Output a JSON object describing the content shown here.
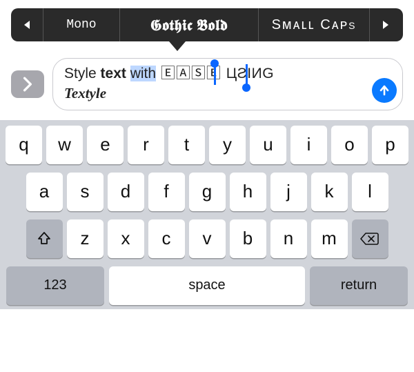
{
  "picker": {
    "prev_icon": "◀",
    "next_icon": "▶",
    "items": [
      "Mono",
      "𝕲𝖔𝖙𝖍𝖎𝖈 𝕭𝖔𝖑𝖉",
      "Sᴍᴀʟʟ Cᴀᴘs"
    ],
    "active_index": 1
  },
  "compose": {
    "segments": {
      "a": "Style ",
      "b": "text ",
      "c": "with",
      "d": " 🄴🄰🅂🄴 ",
      "e": "ЦƧIИG",
      "f": "Textyle"
    }
  },
  "keyboard": {
    "row1": [
      "q",
      "w",
      "e",
      "r",
      "t",
      "y",
      "u",
      "i",
      "o",
      "p"
    ],
    "row2": [
      "a",
      "s",
      "d",
      "f",
      "g",
      "h",
      "j",
      "k",
      "l"
    ],
    "row3": [
      "z",
      "x",
      "c",
      "v",
      "b",
      "n",
      "m"
    ],
    "shift": "⇧",
    "backspace": "⌫",
    "numbers": "123",
    "space": "space",
    "return": "return"
  }
}
